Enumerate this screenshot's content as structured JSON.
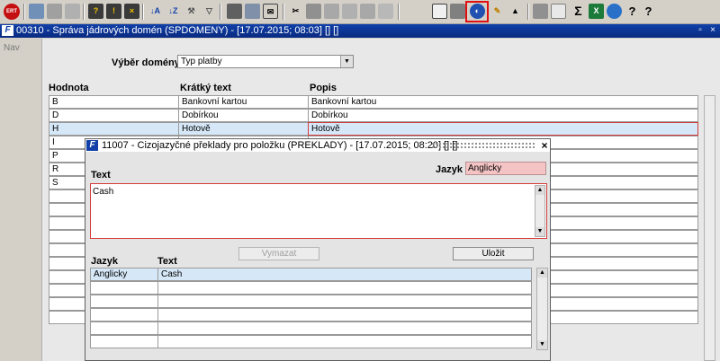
{
  "toolbar": {
    "exit_label": "ERT",
    "icons": [
      "exit-icon",
      "save-icon",
      "new-record-icon",
      "delete-record-icon",
      "query-icon",
      "execute-query-icon",
      "cancel-query-icon",
      "sort-asc-icon",
      "sort-desc-icon",
      "wrench-icon",
      "filter-icon",
      "print-icon",
      "print-preview-icon",
      "mail-icon",
      "cut-icon",
      "copy-icon",
      "paste-icon",
      "zoom-icon",
      "edit-field-icon",
      "form-icon",
      "calendar-icon",
      "translate-icon",
      "highlight-icon",
      "triangle-icon",
      "report-icon",
      "envelope-icon",
      "sum-icon",
      "excel-icon",
      "web-icon",
      "help-icon",
      "context-help-icon"
    ],
    "sum_glyph": "Σ"
  },
  "main_window": {
    "title": "00310 - Správa jádrových domén (SPDOMENY) - [17.07.2015; 08:03] [] []",
    "nav_label": "Nav",
    "domain_select_label": "Výběr domény",
    "domain_select_value": "Typ platby",
    "columns": {
      "hodnota": "Hodnota",
      "kratky": "Krátký text",
      "popis": "Popis"
    },
    "rows": [
      {
        "hodnota": "B",
        "kratky": "Bankovní kartou",
        "popis": "Bankovní kartou"
      },
      {
        "hodnota": "D",
        "kratky": "Dobírkou",
        "popis": "Dobírkou"
      },
      {
        "hodnota": "H",
        "kratky": "Hotově",
        "popis": "Hotově"
      },
      {
        "hodnota": "I",
        "kratky": "",
        "popis": ""
      },
      {
        "hodnota": "P",
        "kratky": "",
        "popis": ""
      },
      {
        "hodnota": "R",
        "kratky": "",
        "popis": ""
      },
      {
        "hodnota": "S",
        "kratky": "",
        "popis": ""
      }
    ],
    "selected_row": 2
  },
  "dialog": {
    "title": "11007 - Cizojazyčné překlady pro položku (PREKLADY) - [17.07.2015; 08:20] [] []",
    "text_label": "Text",
    "jazyk_label": "Jazyk",
    "jazyk_value": "Anglicky",
    "text_value": "Cash",
    "btn_clear": "Vymazat",
    "btn_save": "Uložit",
    "table_header": {
      "jazyk": "Jazyk",
      "text": "Text"
    },
    "rows": [
      {
        "jazyk": "Anglicky",
        "text": "Cash"
      }
    ]
  },
  "colors": {
    "title_bar": "#1040a8",
    "selected_row": "#d6e8f8",
    "active_border": "#d43a3a",
    "language_field": "#f4c4c4",
    "highlight_box": "#e01010"
  }
}
